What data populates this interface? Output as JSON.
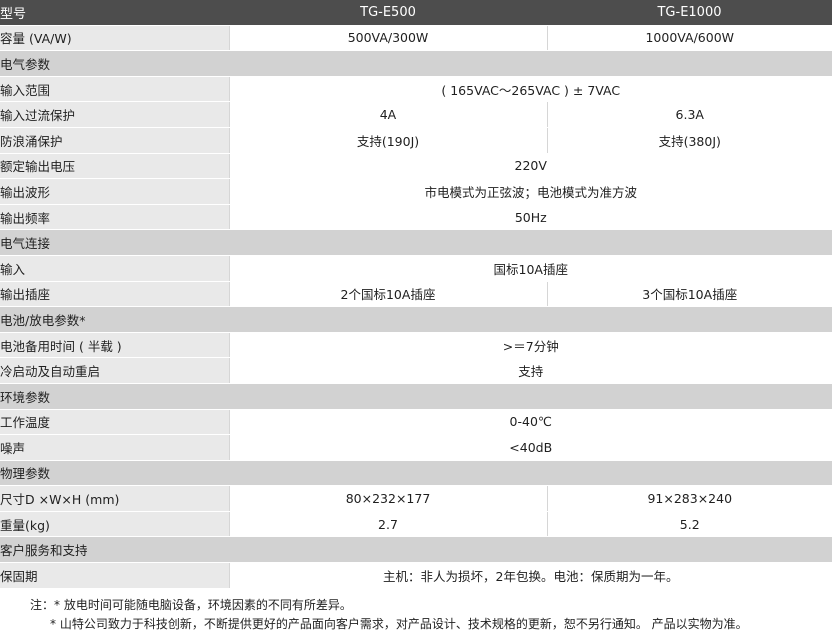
{
  "header": {
    "label": "型号",
    "model_a": "TG-E500",
    "model_b": "TG-E1000"
  },
  "rows": {
    "capacity": {
      "label": "容量 (VA/W)",
      "a": "500VA/300W",
      "b": "1000VA/600W"
    },
    "electrical_section": "电气参数",
    "input_range": {
      "label": "输入范围",
      "value": "( 165VAC～265VAC ) ± 7VAC"
    },
    "input_overcurrent": {
      "label": "输入过流保护",
      "a": "4A",
      "b": "6.3A"
    },
    "surge": {
      "label": "防浪涌保护",
      "a": "支持(190J)",
      "b": "支持(380J)"
    },
    "rated_voltage": {
      "label": "额定输出电压",
      "value": "220V"
    },
    "waveform": {
      "label": "输出波形",
      "value": "市电模式为正弦波；电池模式为准方波"
    },
    "frequency": {
      "label": "输出频率",
      "value": "50Hz"
    },
    "connection_section": "电气连接",
    "input": {
      "label": "输入",
      "value": "国标10A插座"
    },
    "output_socket": {
      "label": "输出插座",
      "a": "2个国标10A插座",
      "b": "3个国标10A插座"
    },
    "battery_section": "电池/放电参数*",
    "backup_time": {
      "label": "电池备用时间 ( 半载 )",
      "value": ">＝7分钟"
    },
    "cold_start": {
      "label": "冷启动及自动重启",
      "value": "支持"
    },
    "env_section": "环境参数",
    "temperature": {
      "label": "工作温度",
      "value": "0-40℃"
    },
    "noise": {
      "label": "噪声",
      "value": "<40dB"
    },
    "physical_section": "物理参数",
    "dimensions": {
      "label": "尺寸D ×W×H (mm)",
      "a": "80×232×177",
      "b": "91×283×240"
    },
    "weight": {
      "label": "重量(kg)",
      "a": "2.7",
      "b": "5.2"
    },
    "service_section": "客户服务和支持",
    "warranty": {
      "label": "保固期",
      "value": "主机：非人为损坏，2年包换。电池：保质期为一年。"
    }
  },
  "notes": {
    "line1": "注：* 放电时间可能随电脑设备，环境因素的不同有所差异。",
    "line2": "* 山特公司致力于科技创新，不断提供更好的产品面向客户需求，对产品设计、技术规格的更新，恕不另行通知。 产品以实物为准。"
  }
}
